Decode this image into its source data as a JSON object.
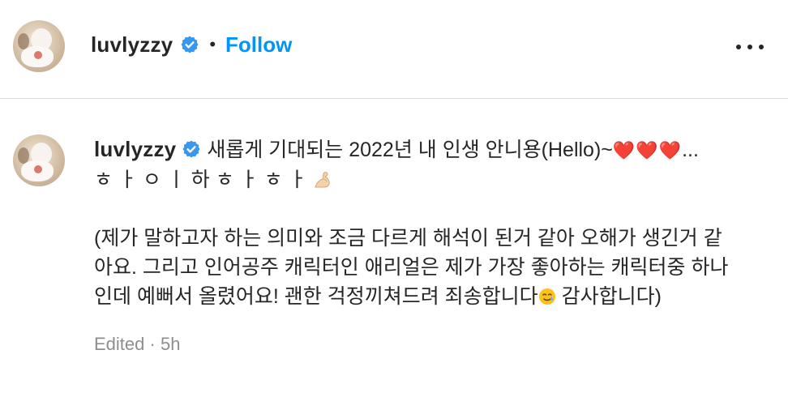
{
  "post_header": {
    "username": "luvlyzzy",
    "separator": "•",
    "follow_label": "Follow"
  },
  "comment": {
    "username": "luvlyzzy",
    "line1": "새롭게 기대되는 2022년 내 인생 안니용(Hello)~",
    "hearts": "❤️❤️❤️",
    "ellipsis": "...",
    "line2": "ㅎ ㅏ ㅇ ㅣ 하 ㅎ ㅏ ㅎ ㅏ",
    "paragraph_line1": "(제가 말하고자 하는 의미와 조금 다르게 해석이 된거 같아 오해가 생긴거 같",
    "paragraph_line2": "아요. 그리고 인어공주 캐릭터인 애리얼은 제가 가장 좋아하는 캐릭터중 하나",
    "paragraph_line3a": "인데 예뻐서 올렸어요! 괜한 걱정끼쳐드려 죄송합니다",
    "paragraph_line3b": " 감사합니다)",
    "edited_label": "Edited",
    "meta_separator": " · ",
    "timestamp": "5h"
  },
  "icons": {
    "verified": "verified-badge-icon",
    "more": "more-options-icon",
    "arm": "flexed-biceps-emoji",
    "face": "smiling-face-with-tear-emoji"
  },
  "colors": {
    "follow": "#0095f6",
    "verified": "#3897f0",
    "text": "#262626",
    "meta": "#8e8e8e",
    "divider": "#dbdbdb"
  }
}
